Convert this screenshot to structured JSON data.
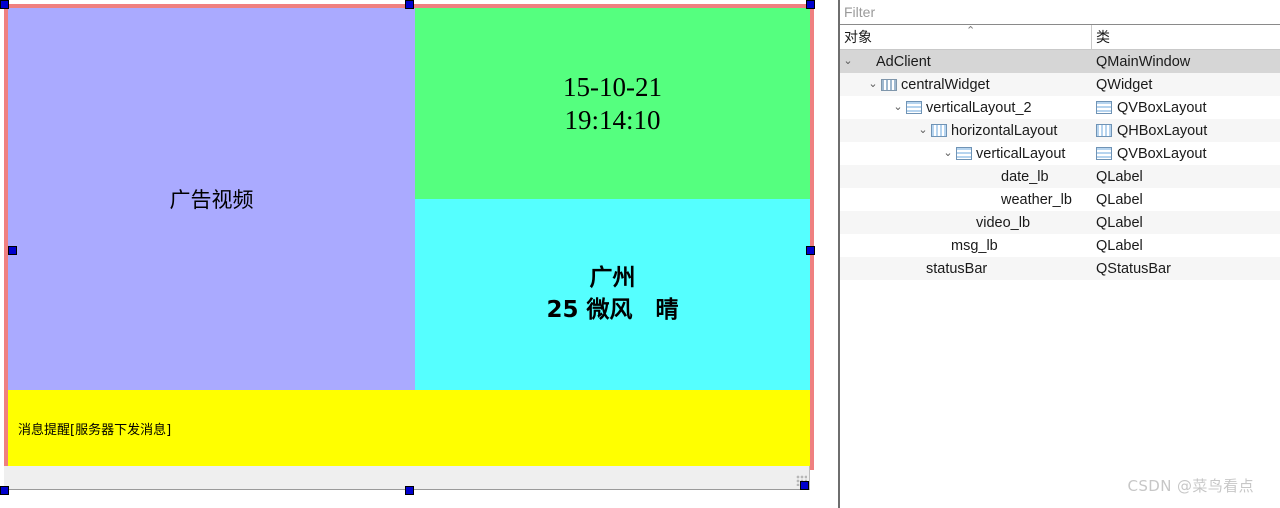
{
  "form": {
    "video_label": {
      "text": "广告视频",
      "color": "#aaaaff"
    },
    "date_label": {
      "line1": "15-10-21",
      "line2": "19:14:10",
      "color": "#55ff7f"
    },
    "weather_label": {
      "line1": "广州",
      "line2": "25 微风　晴",
      "color": "#55ffff"
    },
    "message_label": {
      "text": "消息提醒[服务器下发消息]",
      "color": "#ffff00"
    },
    "status_bar": {
      "text": "",
      "color": "#efefef"
    },
    "selection_border_color": "#ef8080",
    "handle_color": "#0000cd"
  },
  "inspector": {
    "filter": {
      "value": "",
      "placeholder": "Filter"
    },
    "columns": {
      "object": "对象",
      "class": "类",
      "sort_indicator": "⌃"
    },
    "rows": [
      {
        "name": "AdClient",
        "class": "QMainWindow",
        "indent": 0,
        "twisty": "⌄",
        "icon": "none",
        "class_icon": "none",
        "selected": true
      },
      {
        "name": "centralWidget",
        "class": "QWidget",
        "indent": 1,
        "twisty": "⌄",
        "icon": "widget",
        "class_icon": "none",
        "selected": false
      },
      {
        "name": "verticalLayout_2",
        "class": "QVBoxLayout",
        "indent": 2,
        "twisty": "⌄",
        "icon": "vbox",
        "class_icon": "vbox",
        "selected": false
      },
      {
        "name": "horizontalLayout",
        "class": "QHBoxLayout",
        "indent": 3,
        "twisty": "⌄",
        "icon": "hbox",
        "class_icon": "hbox",
        "selected": false
      },
      {
        "name": "verticalLayout",
        "class": "QVBoxLayout",
        "indent": 4,
        "twisty": "⌄",
        "icon": "vbox",
        "class_icon": "vbox",
        "selected": false
      },
      {
        "name": "date_lb",
        "class": "QLabel",
        "indent": 5,
        "twisty": "",
        "icon": "none",
        "class_icon": "none",
        "selected": false
      },
      {
        "name": "weather_lb",
        "class": "QLabel",
        "indent": 5,
        "twisty": "",
        "icon": "none",
        "class_icon": "none",
        "selected": false
      },
      {
        "name": "video_lb",
        "class": "QLabel",
        "indent": 4,
        "twisty": "",
        "icon": "none",
        "class_icon": "none",
        "selected": false
      },
      {
        "name": "msg_lb",
        "class": "QLabel",
        "indent": 3,
        "twisty": "",
        "icon": "none",
        "class_icon": "none",
        "selected": false
      },
      {
        "name": "statusBar",
        "class": "QStatusBar",
        "indent": 2,
        "twisty": "",
        "icon": "none",
        "class_icon": "none",
        "selected": false
      }
    ]
  },
  "watermark": {
    "text": "CSDN @菜鸟看点"
  }
}
